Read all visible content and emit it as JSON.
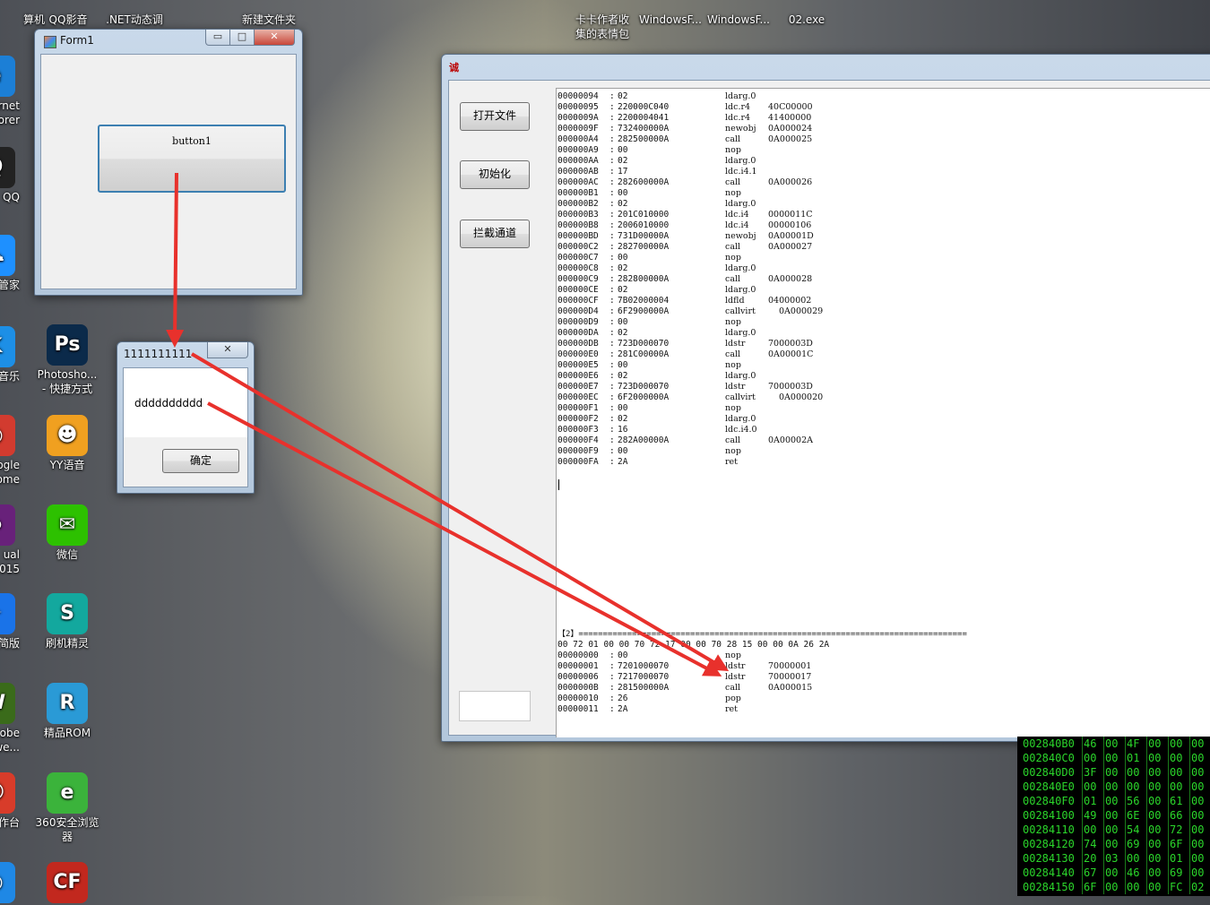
{
  "desktop": {
    "top_icons": [
      {
        "name": "computer",
        "label": "算机"
      },
      {
        "name": "qq-video",
        "label": "QQ影音"
      },
      {
        "name": "net-dynamic",
        "label": ".NET动态调"
      },
      {
        "name": "new-folder",
        "label": "新建文件夹"
      },
      {
        "name": "emoji-pack",
        "label": "卡卡作者收\n集的表情包"
      },
      {
        "name": "windowsf-1",
        "label": "WindowsF..."
      },
      {
        "name": "windowsf-2",
        "label": "WindowsF..."
      },
      {
        "name": "exe-02",
        "label": "02.exe"
      }
    ],
    "left_icons": [
      {
        "name": "ie",
        "label": "rnet\norer",
        "color": "#1c7fd6",
        "glyph": "e"
      },
      {
        "name": "qq",
        "label": "QQ",
        "color": "#222222",
        "glyph": "Q"
      },
      {
        "name": "manager",
        "label": "云管家",
        "color": "#1e90ff",
        "glyph": "☁"
      },
      {
        "name": "music",
        "label": "音乐",
        "color": "#1d8fe6",
        "glyph": "K"
      },
      {
        "name": "chrome",
        "label": "ogle\nome",
        "color": "#d23b2f",
        "glyph": "◉"
      },
      {
        "name": "visual-studio",
        "label": "ual\no 2015",
        "color": "#68217a",
        "glyph": "∞"
      },
      {
        "name": "lite",
        "label": "精简版",
        "color": "#1a73e8",
        "glyph": "✦"
      },
      {
        "name": "dreamweaver",
        "label": "obe\nmwe...",
        "color": "#3a6b1a",
        "glyph": "W"
      },
      {
        "name": "workbench",
        "label": "工作台",
        "color": "#d83c2a",
        "glyph": "☺"
      },
      {
        "name": "browser-blue",
        "label": "",
        "color": "#1f88e5",
        "glyph": "◎"
      }
    ],
    "second_icons": [
      {
        "name": "photoshop",
        "label": "Photosho...\n- 快捷方式",
        "color": "#0b2a4a",
        "glyph": "Ps"
      },
      {
        "name": "yy",
        "label": "YY语音",
        "color": "#f0a020",
        "glyph": "☻"
      },
      {
        "name": "wechat",
        "label": "微信",
        "color": "#2dc100",
        "glyph": "✉"
      },
      {
        "name": "flash-wizard",
        "label": "刷机精灵",
        "color": "#13a89e",
        "glyph": "S"
      },
      {
        "name": "rom",
        "label": "精品ROM",
        "color": "#2a9ad6",
        "glyph": "R"
      },
      {
        "name": "360-browser",
        "label": "360安全浏览\n器",
        "color": "#3bb33b",
        "glyph": "e"
      },
      {
        "name": "cf",
        "label": "",
        "color": "#c2281e",
        "glyph": "CF"
      }
    ]
  },
  "form1": {
    "title": "Form1",
    "button_label": "button1",
    "controls": {
      "minimize": "▭",
      "maximize": "□",
      "close": "✕"
    }
  },
  "msgbox": {
    "title": "1111111111",
    "message": "dddddddddd",
    "ok_label": "确定",
    "close": "✕"
  },
  "main_window": {
    "title_icon": "诚",
    "buttons": {
      "open_file": "打开文件",
      "init": "初始化",
      "intercept": "拦截通道"
    },
    "il_listing": [
      [
        "00000094",
        "02",
        "ldarg.0",
        ""
      ],
      [
        "00000095",
        "220000C040",
        "ldc.r4",
        "40C00000"
      ],
      [
        "0000009A",
        "2200004041",
        "ldc.r4",
        "41400000"
      ],
      [
        "0000009F",
        "732400000A",
        "newobj",
        "0A000024"
      ],
      [
        "000000A4",
        "282500000A",
        "call",
        "0A000025"
      ],
      [
        "000000A9",
        "00",
        "nop",
        ""
      ],
      [
        "000000AA",
        "02",
        "ldarg.0",
        ""
      ],
      [
        "000000AB",
        "17",
        "ldc.i4.1",
        ""
      ],
      [
        "000000AC",
        "282600000A",
        "call",
        "0A000026"
      ],
      [
        "000000B1",
        "00",
        "nop",
        ""
      ],
      [
        "000000B2",
        "02",
        "ldarg.0",
        ""
      ],
      [
        "000000B3",
        "201C010000",
        "ldc.i4",
        "0000011C"
      ],
      [
        "000000B8",
        "2006010000",
        "ldc.i4",
        "00000106"
      ],
      [
        "000000BD",
        "731D00000A",
        "newobj",
        "0A00001D"
      ],
      [
        "000000C2",
        "282700000A",
        "call",
        "0A000027"
      ],
      [
        "000000C7",
        "00",
        "nop",
        ""
      ],
      [
        "000000C8",
        "02",
        "ldarg.0",
        ""
      ],
      [
        "000000C9",
        "282800000A",
        "call",
        "0A000028"
      ],
      [
        "000000CE",
        "02",
        "ldarg.0",
        ""
      ],
      [
        "000000CF",
        "7B02000004",
        "ldfld",
        "04000002"
      ],
      [
        "000000D4",
        "6F2900000A",
        "callvirt",
        "0A000029"
      ],
      [
        "000000D9",
        "00",
        "nop",
        ""
      ],
      [
        "000000DA",
        "02",
        "ldarg.0",
        ""
      ],
      [
        "000000DB",
        "723D000070",
        "ldstr",
        "7000003D"
      ],
      [
        "000000E0",
        "281C00000A",
        "call",
        "0A00001C"
      ],
      [
        "000000E5",
        "00",
        "nop",
        ""
      ],
      [
        "000000E6",
        "02",
        "ldarg.0",
        ""
      ],
      [
        "000000E7",
        "723D000070",
        "ldstr",
        "7000003D"
      ],
      [
        "000000EC",
        "6F2000000A",
        "callvirt",
        "0A000020"
      ],
      [
        "000000F1",
        "00",
        "nop",
        ""
      ],
      [
        "000000F2",
        "02",
        "ldarg.0",
        ""
      ],
      [
        "000000F3",
        "16",
        "ldc.i4.0",
        ""
      ],
      [
        "000000F4",
        "282A00000A",
        "call",
        "0A00002A"
      ],
      [
        "000000F9",
        "00",
        "nop",
        ""
      ],
      [
        "000000FA",
        "2A",
        "ret",
        ""
      ]
    ],
    "section_header": "【2】================================================================================",
    "bytes_line": "00 72 01 00 00 70 72 17 00 00 70 28 15 00 00 0A 26 2A",
    "il_listing_2": [
      [
        "00000000",
        "00",
        "nop",
        ""
      ],
      [
        "00000001",
        "7201000070",
        "ldstr",
        "70000001"
      ],
      [
        "00000006",
        "7217000070",
        "ldstr",
        "70000017"
      ],
      [
        "0000000B",
        "281500000A",
        "call",
        "0A000015"
      ],
      [
        "00000010",
        "26",
        "pop",
        ""
      ],
      [
        "00000011",
        "2A",
        "ret",
        ""
      ]
    ]
  },
  "hex_view": {
    "rows": [
      [
        "002840B0",
        "46",
        "00",
        "4F",
        "00",
        "00",
        "00"
      ],
      [
        "002840C0",
        "00",
        "00",
        "01",
        "00",
        "00",
        "00"
      ],
      [
        "002840D0",
        "3F",
        "00",
        "00",
        "00",
        "00",
        "00"
      ],
      [
        "002840E0",
        "00",
        "00",
        "00",
        "00",
        "00",
        "00"
      ],
      [
        "002840F0",
        "01",
        "00",
        "56",
        "00",
        "61",
        "00"
      ],
      [
        "00284100",
        "49",
        "00",
        "6E",
        "00",
        "66",
        "00"
      ],
      [
        "00284110",
        "00",
        "00",
        "54",
        "00",
        "72",
        "00"
      ],
      [
        "00284120",
        "74",
        "00",
        "69",
        "00",
        "6F",
        "00"
      ],
      [
        "00284130",
        "20",
        "03",
        "00",
        "00",
        "01",
        "00"
      ],
      [
        "00284140",
        "67",
        "00",
        "46",
        "00",
        "69",
        "00"
      ],
      [
        "00284150",
        "6F",
        "00",
        "00",
        "00",
        "FC",
        "02"
      ]
    ]
  },
  "colors": {
    "arrow": "#e8312c",
    "hex_text": "#2bd62b",
    "button_border": "#3c7fb1"
  }
}
